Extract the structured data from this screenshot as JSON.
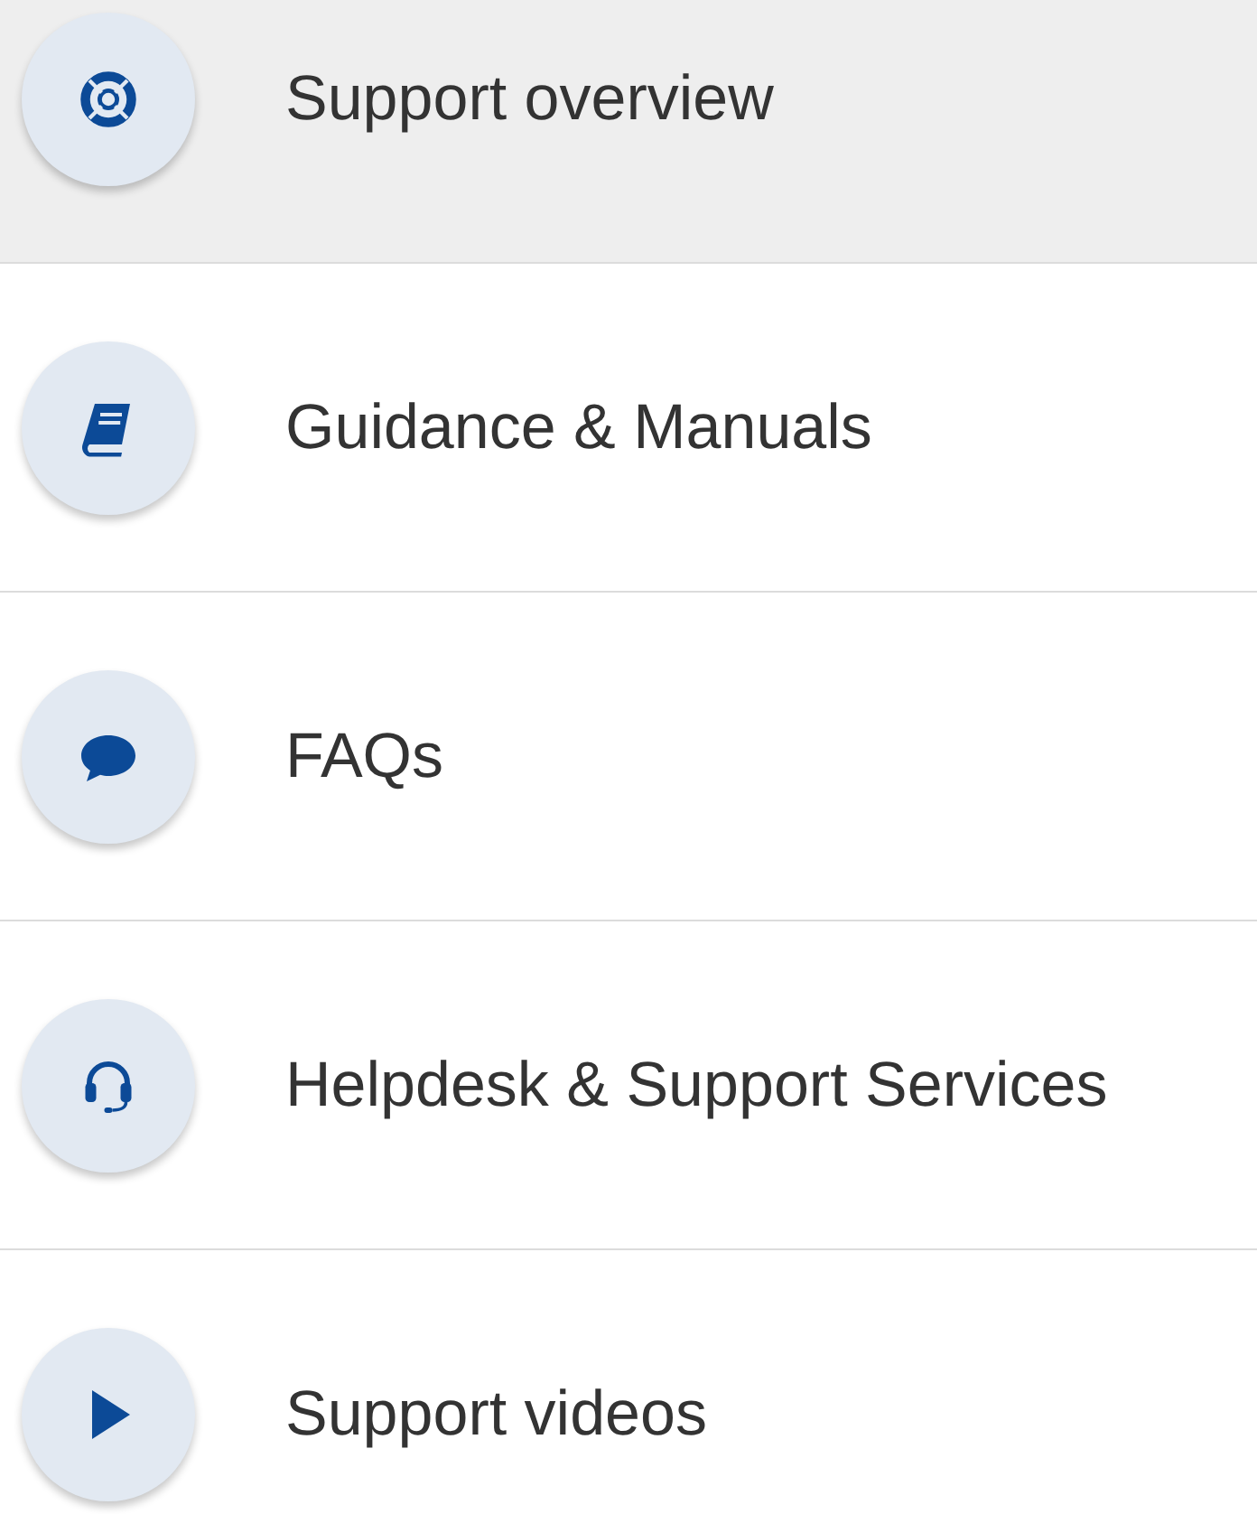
{
  "menu": {
    "items": [
      {
        "label": "Support overview",
        "kind": "lifebuoy",
        "selected": true
      },
      {
        "label": "Guidance & Manuals",
        "kind": "book",
        "selected": false
      },
      {
        "label": "FAQs",
        "kind": "chat",
        "selected": false
      },
      {
        "label": "Helpdesk & Support Services",
        "kind": "headset",
        "selected": false
      },
      {
        "label": "Support videos",
        "kind": "play",
        "selected": false
      }
    ]
  }
}
